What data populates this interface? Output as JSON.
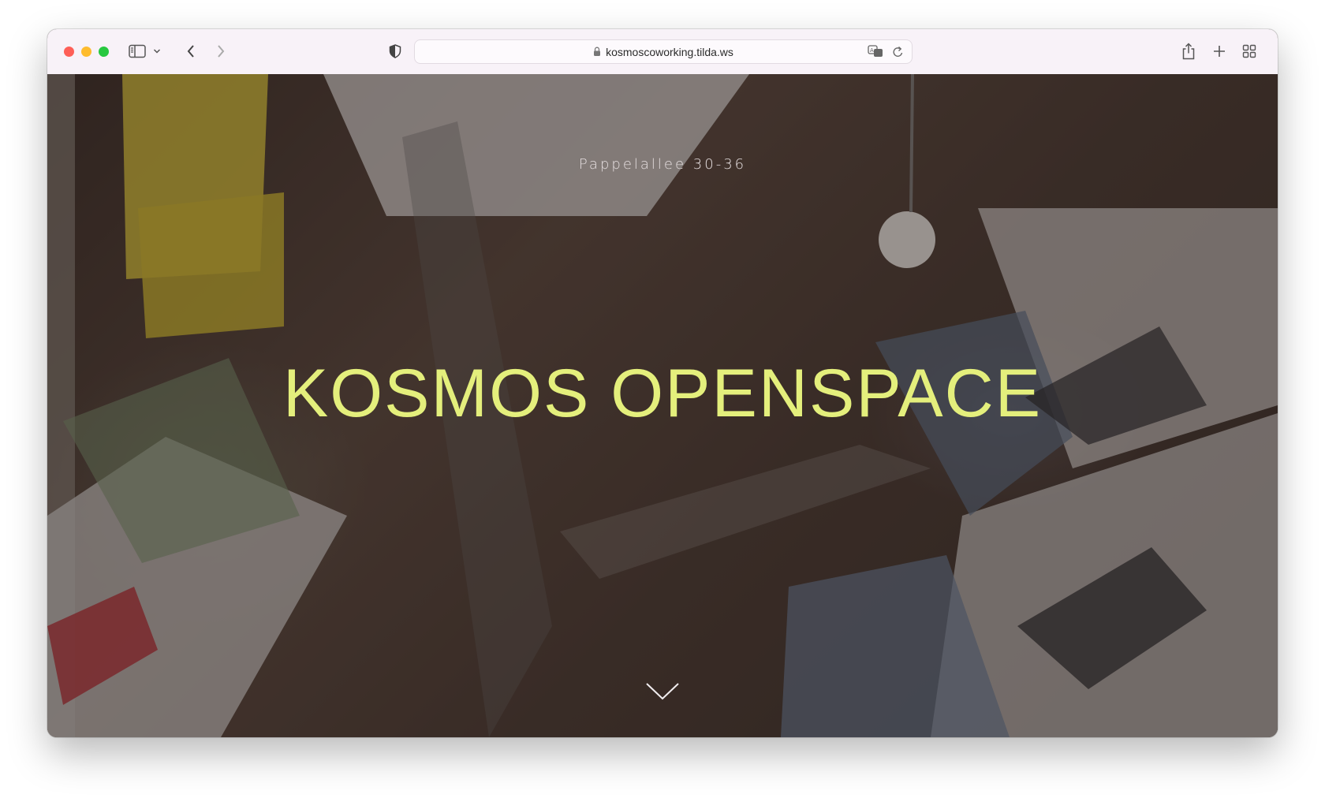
{
  "browser": {
    "url": "kosmoscoworking.tilda.ws",
    "icons": {
      "sidebar": "sidebar-icon",
      "back": "chevron-left-icon",
      "forward": "chevron-right-icon",
      "privacy": "shield-icon",
      "lock": "lock-icon",
      "translate": "translate-icon",
      "reload": "reload-icon",
      "share": "share-icon",
      "new_tab": "plus-icon",
      "tab_overview": "grid-icon"
    },
    "traffic_colors": [
      "#fe5f57",
      "#febc2e",
      "#28c840"
    ]
  },
  "hero": {
    "subtitle": "Pappelallee 30-36",
    "title": "KOSMOS OPENSPACE",
    "title_color": "#e4ef7c",
    "scroll_icon": "chevron-down-icon"
  }
}
